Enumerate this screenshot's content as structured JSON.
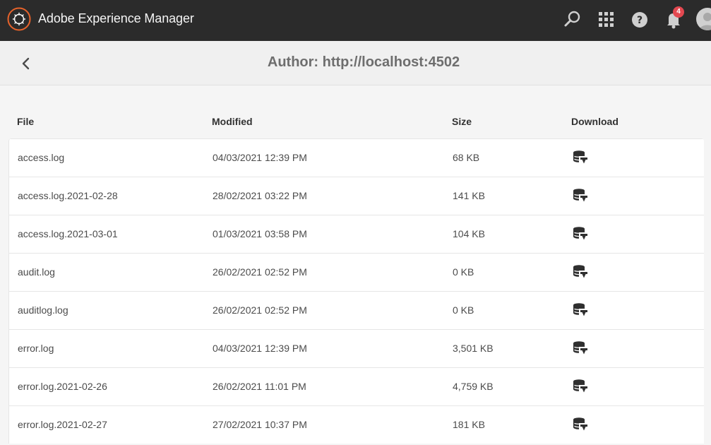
{
  "header": {
    "app_title": "Adobe Experience Manager",
    "notification_count": "4"
  },
  "titlebar": {
    "title": "Author: http://localhost:4502"
  },
  "table": {
    "columns": [
      "File",
      "Modified",
      "Size",
      "Download"
    ],
    "rows": [
      {
        "file": "access.log",
        "modified": "04/03/2021 12:39 PM",
        "size": "68 KB"
      },
      {
        "file": "access.log.2021-02-28",
        "modified": "28/02/2021 03:22 PM",
        "size": "141 KB"
      },
      {
        "file": "access.log.2021-03-01",
        "modified": "01/03/2021 03:58 PM",
        "size": "104 KB"
      },
      {
        "file": "audit.log",
        "modified": "26/02/2021 02:52 PM",
        "size": "0 KB"
      },
      {
        "file": "auditlog.log",
        "modified": "26/02/2021 02:52 PM",
        "size": "0 KB"
      },
      {
        "file": "error.log",
        "modified": "04/03/2021 12:39 PM",
        "size": "3,501 KB"
      },
      {
        "file": "error.log.2021-02-26",
        "modified": "26/02/2021 11:01 PM",
        "size": "4,759 KB"
      },
      {
        "file": "error.log.2021-02-27",
        "modified": "27/02/2021 10:37 PM",
        "size": "181 KB"
      }
    ]
  }
}
